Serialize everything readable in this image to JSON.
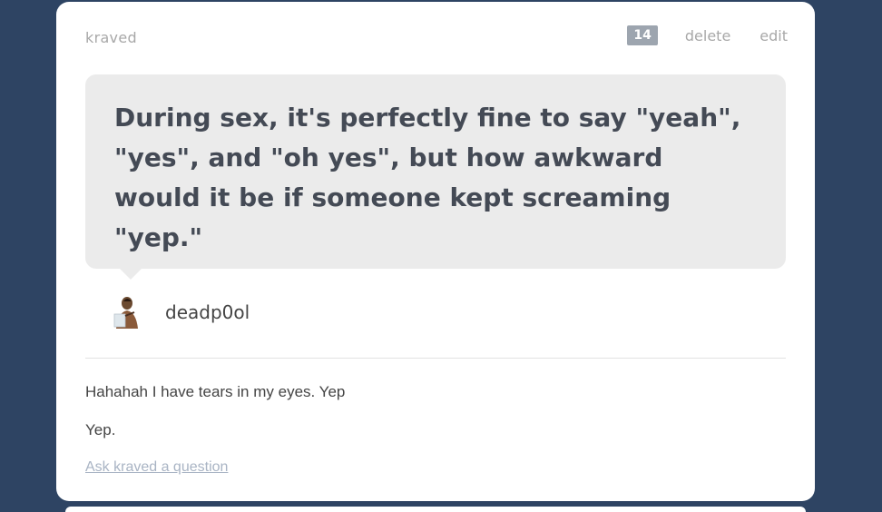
{
  "post": {
    "username": "kraved",
    "note_count": "14",
    "delete_label": "delete",
    "edit_label": "edit",
    "question": "During sex, it's perfectly fine to say \"yeah\", \"yes\", and \"oh yes\", but how awkward would it be if someone kept screaming \"yep.\"",
    "asker": "deadp0ol",
    "answer_lines": [
      "Hahahah I have tears in my eyes. Yep",
      "Yep."
    ],
    "ask_link": "Ask kraved a question"
  },
  "colors": {
    "background": "#2e4463",
    "card": "#ffffff",
    "bubble": "#ebebeb",
    "question_text": "#444a55",
    "muted": "#a8a8a8",
    "link": "#a9b4c4"
  },
  "icons": {
    "avatar": "user-avatar-icon"
  }
}
